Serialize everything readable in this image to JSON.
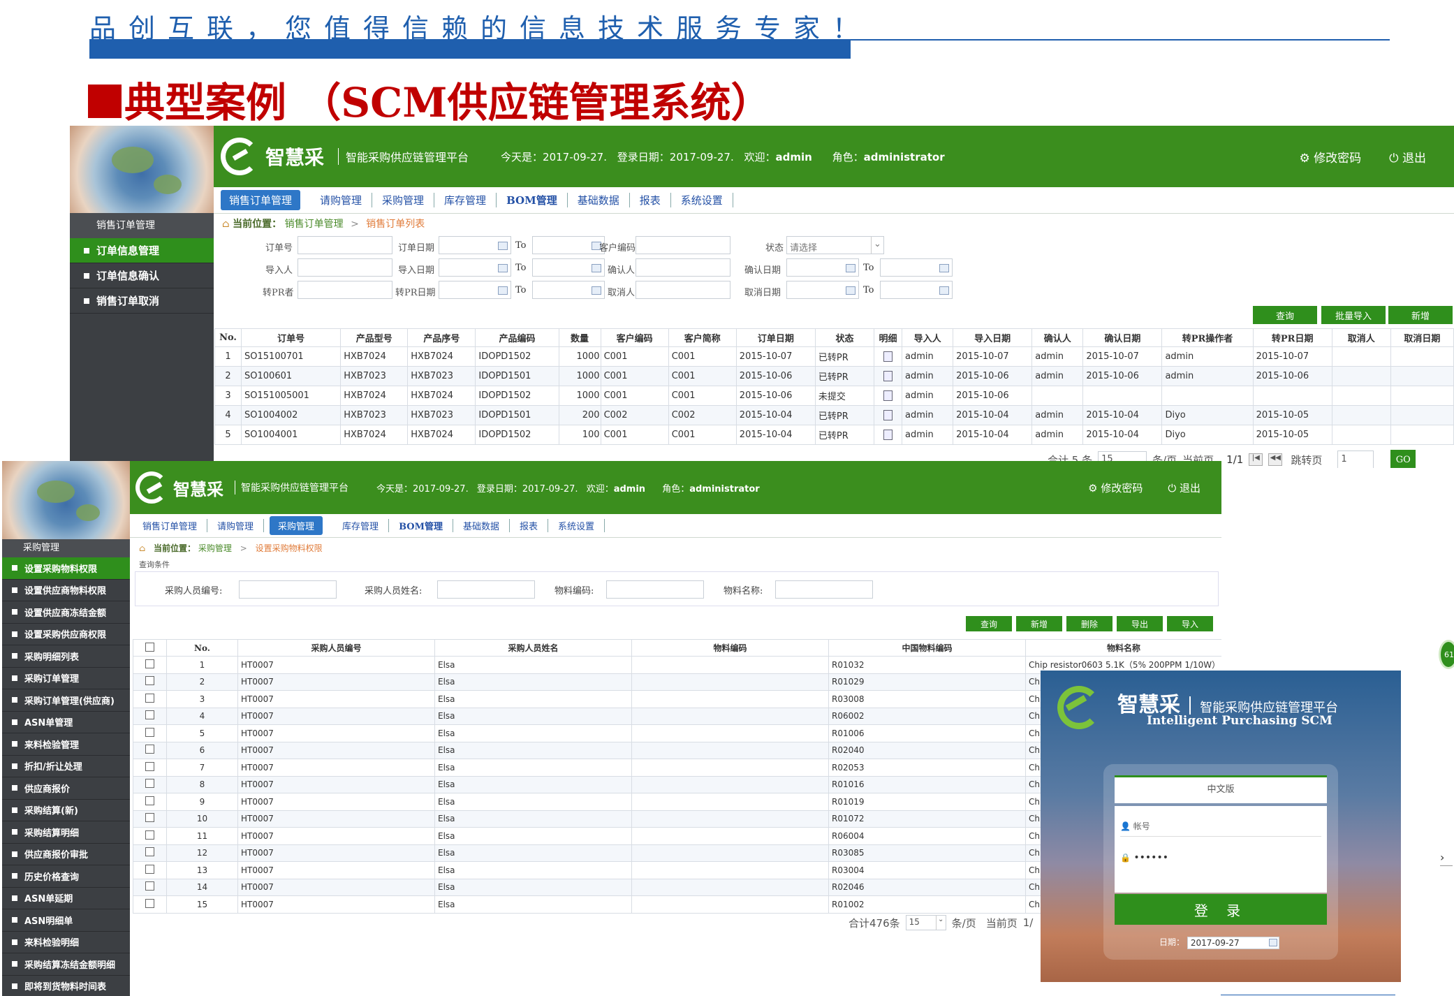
{
  "slogan": "品创互联，您值得信赖的信息技术服务专家！",
  "slide_title": "典型案例  （SCM供应链管理系统）",
  "brand": {
    "name": "智慧采",
    "subtitle": "智能采购供应链管理平台",
    "en": "Intelligent Purchasing SCM"
  },
  "topbar": {
    "today_label": "今天是：",
    "today": "2017-09-27.",
    "login_label": "登录日期：",
    "login_date": "2017-09-27.",
    "welcome_label": "欢迎：",
    "user": "admin",
    "role_label": "角色：",
    "role": "administrator",
    "change_pw": "修改密码",
    "logout": "退出"
  },
  "nav": [
    "销售订单管理",
    "请购管理",
    "采购管理",
    "库存管理",
    "BOM管理",
    "基础数据",
    "报表",
    "系统设置"
  ],
  "win1": {
    "sidebar_title": "销售订单管理",
    "sidebar_items": [
      "订单信息管理",
      "订单信息确认",
      "销售订单取消"
    ],
    "breadcrumb": {
      "label": "当前位置：",
      "path1": "销售订单管理",
      "sep": ">",
      "path2": "销售订单列表"
    },
    "filters": {
      "order_no": "订单号",
      "order_date": "订单日期",
      "to": "To",
      "cust_code": "客户编码",
      "status": "状态",
      "status_ph": "请选择",
      "importer": "导入人",
      "import_date": "导入日期",
      "confirmer": "确认人",
      "confirm_date": "确认日期",
      "pr_user": "转PR者",
      "pr_date": "转PR日期",
      "canceler": "取消人",
      "cancel_date": "取消日期"
    },
    "buttons": {
      "query": "查询",
      "batch_import": "批量导入",
      "add": "新增"
    },
    "columns": [
      "No.",
      "订单号",
      "产品型号",
      "产品序号",
      "产品编码",
      "数量",
      "客户编码",
      "客户简称",
      "订单日期",
      "状态",
      "明细",
      "导入人",
      "导入日期",
      "确认人",
      "确认日期",
      "转PR操作者",
      "转PR日期",
      "取消人",
      "取消日期"
    ],
    "rows": [
      [
        "1",
        "SO15100701",
        "HXB7024",
        "HXB7024",
        "IDOPD1502",
        "1000",
        "C001",
        "C001",
        "2015-10-07",
        "已转PR",
        "",
        "admin",
        "2015-10-07",
        "admin",
        "2015-10-07",
        "admin",
        "2015-10-07",
        "",
        ""
      ],
      [
        "2",
        "SO100601",
        "HXB7023",
        "HXB7023",
        "IDOPD1501",
        "1000",
        "C001",
        "C001",
        "2015-10-06",
        "已转PR",
        "",
        "admin",
        "2015-10-06",
        "admin",
        "2015-10-06",
        "admin",
        "2015-10-06",
        "",
        ""
      ],
      [
        "3",
        "SO151005001",
        "HXB7024",
        "HXB7024",
        "IDOPD1502",
        "1000",
        "C001",
        "C001",
        "2015-10-06",
        "未提交",
        "",
        "admin",
        "2015-10-06",
        "",
        "",
        "",
        "",
        "",
        ""
      ],
      [
        "4",
        "SO1004002",
        "HXB7023",
        "HXB7023",
        "IDOPD1501",
        "200",
        "C002",
        "C002",
        "2015-10-04",
        "已转PR",
        "",
        "admin",
        "2015-10-04",
        "admin",
        "2015-10-04",
        "Diyo",
        "2015-10-05",
        "",
        ""
      ],
      [
        "5",
        "SO1004001",
        "HXB7024",
        "HXB7024",
        "IDOPD1502",
        "100",
        "C001",
        "C001",
        "2015-10-04",
        "已转PR",
        "",
        "admin",
        "2015-10-04",
        "admin",
        "2015-10-04",
        "Diyo",
        "2015-10-05",
        "",
        ""
      ]
    ],
    "pager": {
      "total": "合计 5 条",
      "per_page": "15",
      "unit": "条/页",
      "current_label": "当前页",
      "pages": "1/1",
      "jump": "跳转页",
      "page_input": "1",
      "go": "GO"
    }
  },
  "win2": {
    "sidebar_title": "采购管理",
    "sidebar_items": [
      "设置采购物料权限",
      "设置供应商物料权限",
      "设置供应商冻结金额",
      "设置采购供应商权限",
      "采购明细列表",
      "采购订单管理",
      "采购订单管理(供应商)",
      "ASN单管理",
      "来料检验管理",
      "折扣/折让处理",
      "供应商报价",
      "采购结算(新)",
      "采购结算明细",
      "供应商报价审批",
      "历史价格查询",
      "ASN单延期",
      "ASN明细单",
      "来料检验明细",
      "采购结算冻结金额明细",
      "即将到货物料时间表"
    ],
    "breadcrumb": {
      "label": "当前位置：",
      "path1": "采购管理",
      "sep": ">",
      "path2": "设置采购物料权限"
    },
    "query_label": "查询条件",
    "filters": {
      "buyer_code": "采购人员编号:",
      "buyer_name": "采购人员姓名:",
      "mat_code": "物料编码:",
      "mat_name": "物料名称:"
    },
    "buttons": {
      "query": "查询",
      "add": "新增",
      "delete": "删除",
      "export": "导出",
      "import": "导入"
    },
    "columns": [
      "No.",
      "采购人员编号",
      "采购人员姓名",
      "物料编码",
      "中国物料编码",
      "物料名称"
    ],
    "rows": [
      [
        "1",
        "HT0007",
        "Elsa",
        "",
        "R01032",
        "Chip resistor0603 5.1K（5% 200PPM 1/10W）"
      ],
      [
        "2",
        "HT0007",
        "Elsa",
        "",
        "R01029",
        "Chip"
      ],
      [
        "3",
        "HT0007",
        "Elsa",
        "",
        "R03008",
        "Chip"
      ],
      [
        "4",
        "HT0007",
        "Elsa",
        "",
        "R06002",
        "Chip"
      ],
      [
        "5",
        "HT0007",
        "Elsa",
        "",
        "R01006",
        "Chip"
      ],
      [
        "6",
        "HT0007",
        "Elsa",
        "",
        "R02040",
        "Chip"
      ],
      [
        "7",
        "HT0007",
        "Elsa",
        "",
        "R02053",
        "Chip"
      ],
      [
        "8",
        "HT0007",
        "Elsa",
        "",
        "R01016",
        "Chip"
      ],
      [
        "9",
        "HT0007",
        "Elsa",
        "",
        "R01019",
        "Chip"
      ],
      [
        "10",
        "HT0007",
        "Elsa",
        "",
        "R01072",
        "Chip"
      ],
      [
        "11",
        "HT0007",
        "Elsa",
        "",
        "R06004",
        "Chip"
      ],
      [
        "12",
        "HT0007",
        "Elsa",
        "",
        "R03085",
        "Chip"
      ],
      [
        "13",
        "HT0007",
        "Elsa",
        "",
        "R03004",
        "Chip"
      ],
      [
        "14",
        "HT0007",
        "Elsa",
        "",
        "R02046",
        "Chip"
      ],
      [
        "15",
        "HT0007",
        "Elsa",
        "",
        "R01002",
        "Chip"
      ]
    ],
    "pager": {
      "total": "合计476条",
      "per_page": "15",
      "unit": "条/页",
      "current_label": "当前页",
      "pages": "1/"
    }
  },
  "login": {
    "lang": "中文版",
    "account_ph": "帐号",
    "password": "••••••",
    "submit": "登 录",
    "date_label": "日期：",
    "date": "2017-09-27"
  },
  "edge_badge": "61",
  "colors": {
    "green": "#3b8e1e",
    "blue": "#1f5fae",
    "red": "#c00000",
    "nav_active": "#2e77c7",
    "sidebar": "#3c3f43"
  }
}
